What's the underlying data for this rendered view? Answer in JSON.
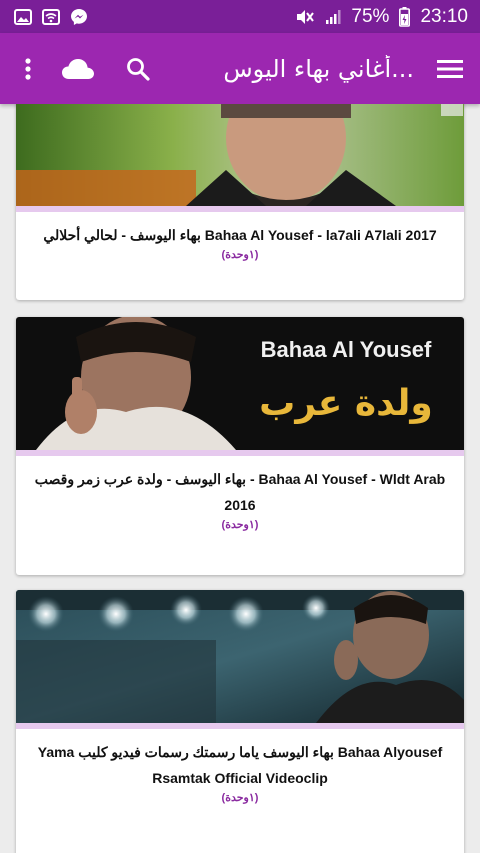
{
  "status_bar": {
    "battery_percent": "75%",
    "time": "23:10",
    "left_icons": [
      "gallery-icon",
      "wifi-icon",
      "messenger-icon"
    ],
    "right_icons": [
      "mute-icon",
      "signal-icon",
      "battery-charging-icon"
    ]
  },
  "app_bar": {
    "title": "أغاني بهاء اليوس...",
    "color": "#9c27b0",
    "status_color": "#7a1f98",
    "icons": [
      "menu-icon",
      "search-icon",
      "cloud-icon",
      "more-vert-icon"
    ]
  },
  "cards": [
    {
      "title": "Bahaa Al Yousef - la7ali A7lali 2017 بهاء اليوسف - لحالي أحلالي",
      "count": "(١وحدة)"
    },
    {
      "title": "Bahaa Al Yousef - Wldt Arab - بهاء اليوسف - ولدة عرب زمر وقصب 2016",
      "count": "(١وحدة)",
      "thumb_text_en": "Bahaa Al Yousef",
      "thumb_text_ar": "ولدة عرب"
    },
    {
      "title": "Bahaa Alyousef بهاء اليوسف ياما رسمتك رسمات فيديو كليب Yama Rsamtak Official Videoclip",
      "count": "(١وحدة)"
    }
  ]
}
